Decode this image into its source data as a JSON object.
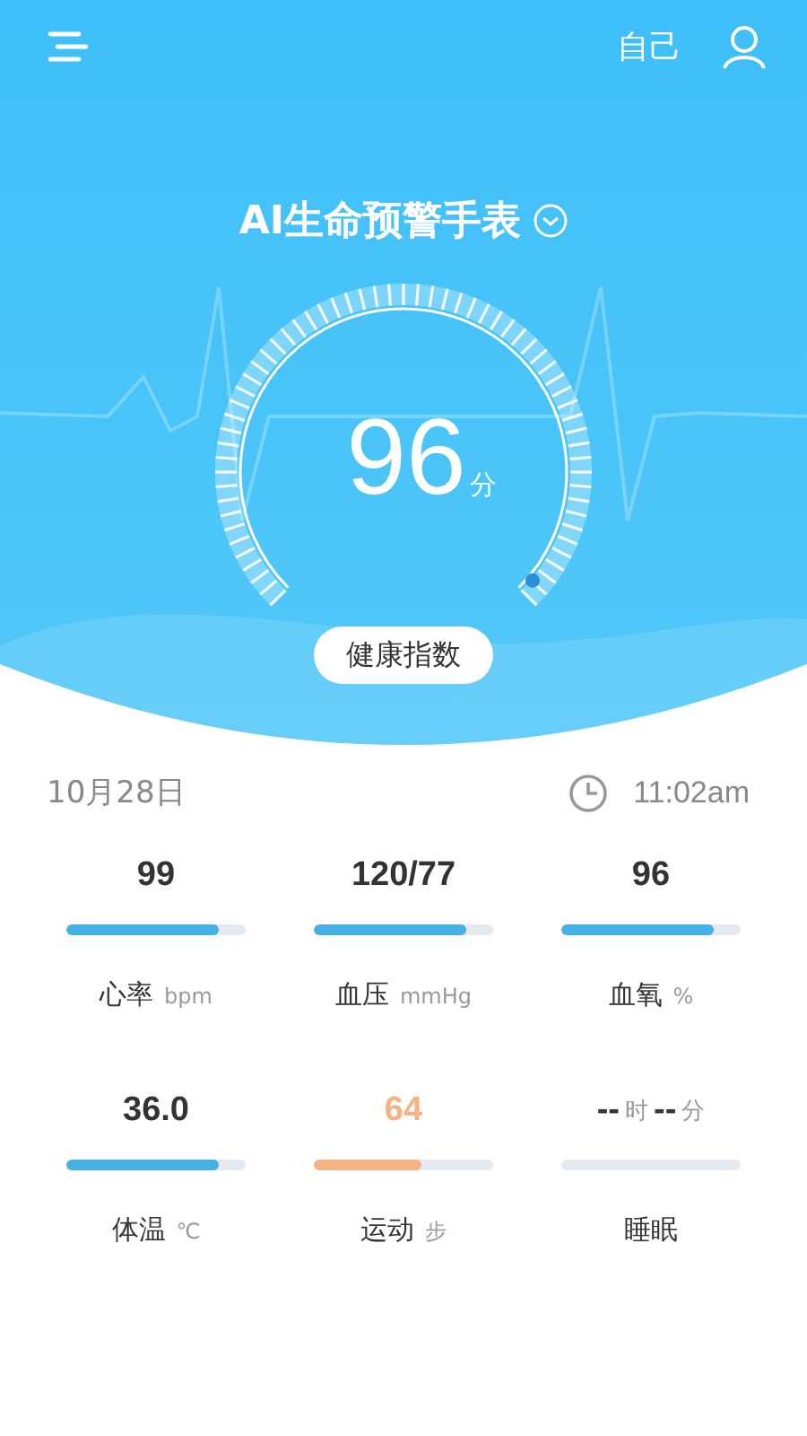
{
  "top_bar": {
    "profile_label": "自己"
  },
  "device": {
    "title": "AI生命预警手表"
  },
  "score": {
    "value": "96",
    "unit": "分",
    "label": "健康指数"
  },
  "date": "10月28日",
  "time": "11:02am",
  "metrics": [
    {
      "value_parts": [
        {
          "kind": "number",
          "text": "99"
        }
      ],
      "tinted": false,
      "level": 0.85,
      "color": "#45b0e6",
      "label": "心率",
      "unit": "bpm"
    },
    {
      "value_parts": [
        {
          "kind": "number",
          "text": "120/77"
        }
      ],
      "tinted": false,
      "level": 0.85,
      "color": "#45b0e6",
      "label": "血压",
      "unit": "mmHg"
    },
    {
      "value_parts": [
        {
          "kind": "number",
          "text": "96"
        }
      ],
      "tinted": false,
      "level": 0.85,
      "color": "#45b0e6",
      "label": "血氧",
      "unit": "%"
    },
    {
      "value_parts": [
        {
          "kind": "number",
          "text": "36.0"
        }
      ],
      "tinted": false,
      "level": 0.85,
      "color": "#45b0e6",
      "label": "体温",
      "unit": "℃"
    },
    {
      "value_parts": [
        {
          "kind": "number",
          "text": "64"
        }
      ],
      "tinted": true,
      "level": 0.6,
      "color": "#f5b283",
      "label": "运动",
      "unit": "步"
    },
    {
      "value_parts": [
        {
          "kind": "number",
          "text": "--"
        },
        {
          "kind": "unit",
          "text": "时"
        },
        {
          "kind": "number",
          "text": "--"
        },
        {
          "kind": "unit",
          "text": "分"
        }
      ],
      "label": "睡眠"
    }
  ]
}
